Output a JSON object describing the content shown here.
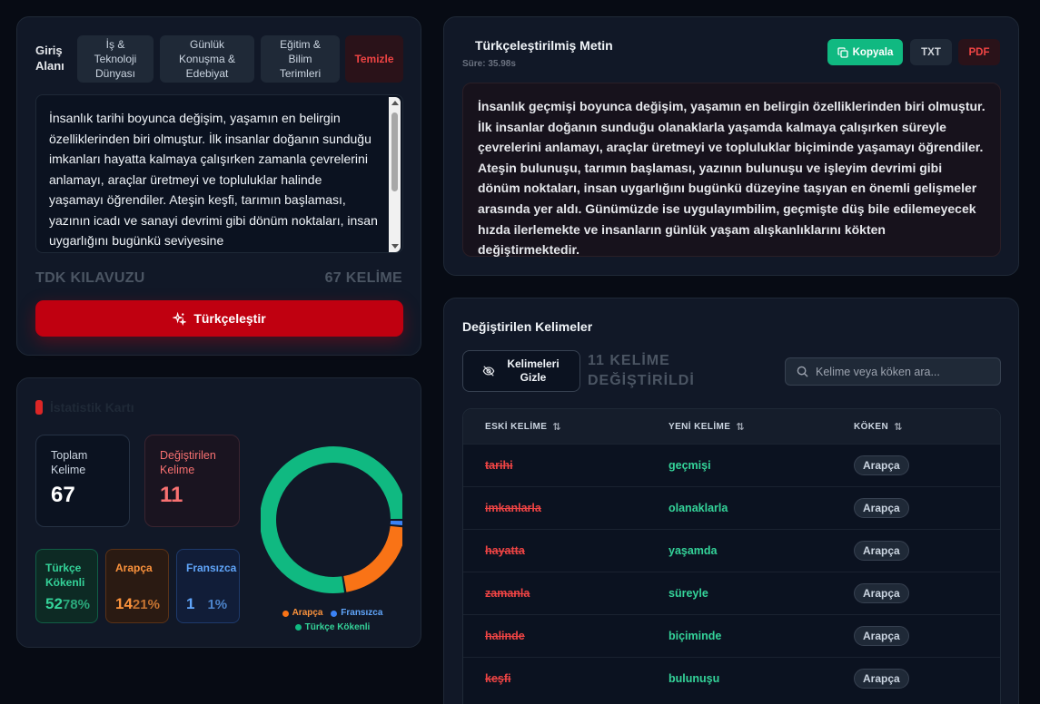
{
  "input": {
    "label": "Giriş Alanı",
    "categories": [
      "İş & Teknoloji Dünyası",
      "Günlük Konuşma & Edebiyat",
      "Eğitim & Bilim Terimleri"
    ],
    "clear_label": "Temizle",
    "text": "İnsanlık tarihi boyunca değişim, yaşamın en belirgin özelliklerinden biri olmuştur. İlk insanlar doğanın sunduğu imkanları hayatta kalmaya çalışırken zamanla çevrelerini anlamayı, araçlar üretmeyi ve topluluklar halinde yaşamayı öğrendiler. Ateşin keşfi, tarımın başlaması, yazının icadı ve sanayi devrimi gibi dönüm noktaları, insan uygarlığını bugünkü seviyesine",
    "guide_label": "TDK KILAVUZU",
    "word_count": "67 KELİME",
    "convert_label": "Türkçeleştir"
  },
  "stats": {
    "title": "İstatistik Kartı",
    "total_label": "Toplam Kelime",
    "total_value": "67",
    "changed_label": "Değiştirilen Kelime",
    "changed_value": "11",
    "origins": [
      {
        "label": "Türkçe Kökenli",
        "count": "52",
        "percent": "78%"
      },
      {
        "label": "Arapça",
        "count": "14",
        "percent": "21%"
      },
      {
        "label": "Fransızca",
        "count": "1",
        "percent": "1%"
      }
    ],
    "chart_data": {
      "type": "pie",
      "categories": [
        "Türkçe Kökenli",
        "Arapça",
        "Fransızca"
      ],
      "values": [
        52,
        14,
        1
      ],
      "colors": [
        "#10b981",
        "#f97316",
        "#3b82f6"
      ]
    },
    "legend": [
      "Arapça",
      "Fransızca",
      "Türkçe Kökenli"
    ]
  },
  "output": {
    "title": "Türkçeleştirilmiş Metin",
    "time": "Süre: 35.98s",
    "copy_label": "Kopyala",
    "txt_label": "TXT",
    "pdf_label": "PDF",
    "text": "İnsanlık geçmişi boyunca değişim, yaşamın en belirgin özelliklerinden biri olmuştur. İlk insanlar doğanın sunduğu olanaklarla yaşamda kalmaya çalışırken süreyle çevrelerini anlamayı, araçlar üretmeyi ve topluluklar biçiminde yaşamayı öğrendiler. Ateşin bulunuşu, tarımın başlaması, yazının bulunuşu ve işleyim devrimi gibi dönüm noktaları, insan uygarlığını bugünkü düzeyine taşıyan en önemli gelişmeler arasında yer aldı. Günümüzde ise uygulayımbilim, geçmişte düş bile edilemeyecek hızda ilerlemekte ve insanların günlük yaşam alışkanlıklarını kökten değiştirmektedir."
  },
  "words": {
    "title": "Değiştirilen Kelimeler",
    "hide_label": "Kelimeleri Gizle",
    "changed_count": "11 KELİME DEĞİŞTİRİLDİ",
    "search_placeholder": "Kelime veya köken ara...",
    "columns": [
      "ESKİ KELİME",
      "YENİ KELİME",
      "KÖKEN"
    ],
    "rows": [
      {
        "old": "tarihi",
        "new": "geçmişi",
        "origin": "Arapça"
      },
      {
        "old": "imkanlarla",
        "new": "olanaklarla",
        "origin": "Arapça"
      },
      {
        "old": "hayatta",
        "new": "yaşamda",
        "origin": "Arapça"
      },
      {
        "old": "zamanla",
        "new": "süreyle",
        "origin": "Arapça"
      },
      {
        "old": "halinde",
        "new": "biçiminde",
        "origin": "Arapça"
      },
      {
        "old": "keşfi",
        "new": "bulunuşu",
        "origin": "Arapça"
      }
    ]
  }
}
